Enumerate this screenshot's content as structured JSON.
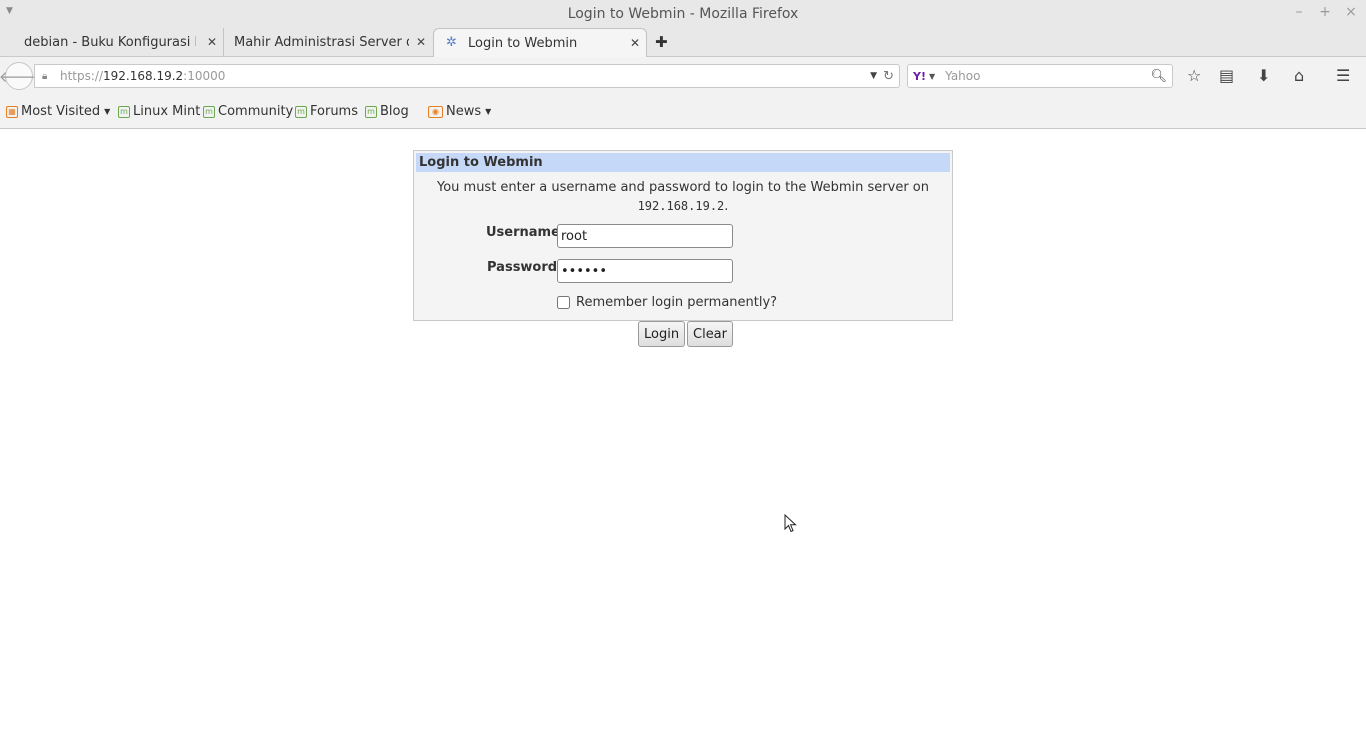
{
  "window": {
    "title": "Login to Webmin - Mozilla Firefox",
    "controls": [
      "–",
      "+",
      "×"
    ]
  },
  "tabs": [
    {
      "label": "debian - Buku Konfigurasi De...",
      "active": false
    },
    {
      "label": "Mahir Administrasi Server da...",
      "active": false
    },
    {
      "label": "Login to Webmin",
      "active": true
    }
  ],
  "toolbar": {
    "url_scheme": "https://",
    "url_host": "192.168.19.2",
    "url_port": ":10000",
    "search_placeholder": "Yahoo",
    "search_engine": "Y!"
  },
  "bookmarks": [
    {
      "label": "Most Visited",
      "icon": "most-visited-icon",
      "dropdown": true
    },
    {
      "label": "Linux Mint",
      "icon": "mint-icon",
      "dropdown": false
    },
    {
      "label": "Community",
      "icon": "mint-icon",
      "dropdown": false
    },
    {
      "label": "Forums",
      "icon": "mint-icon",
      "dropdown": false
    },
    {
      "label": "Blog",
      "icon": "mint-icon",
      "dropdown": false
    },
    {
      "label": "News",
      "icon": "rss-icon",
      "dropdown": true
    }
  ],
  "login": {
    "heading": "Login to Webmin",
    "message": "You must enter a username and password to login to the Webmin server on",
    "server": "192.168.19.2",
    "message_end": ".",
    "username_label": "Username",
    "username_value": "root",
    "password_label": "Password",
    "password_value": "secret",
    "remember_label": "Remember login permanently?",
    "remember_checked": false,
    "login_button": "Login",
    "clear_button": "Clear"
  }
}
